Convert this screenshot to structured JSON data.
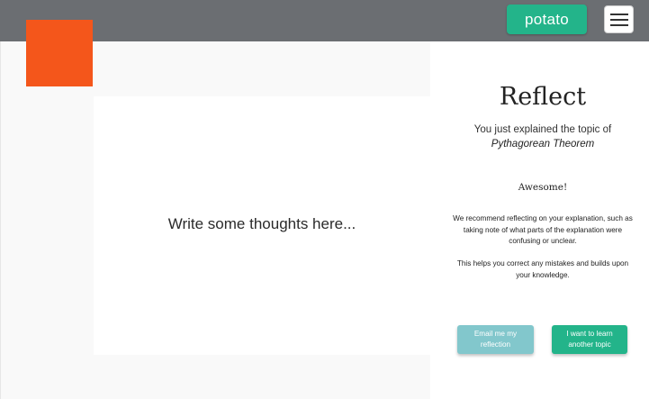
{
  "header": {
    "user_button_label": "potato",
    "menu_icon": "hamburger-menu-icon"
  },
  "notes": {
    "placeholder": "Write some thoughts here..."
  },
  "reflect": {
    "title": "Reflect",
    "intro": "You just explained the topic of",
    "topic": "Pythagorean Theorem",
    "awesome": "Awesome!",
    "recommendation": "We recommend reflecting on your explanation, such as taking note of what parts of the explanation were confusing or unclear.",
    "help": "This helps you correct any mistakes and builds upon your knowledge.",
    "email_button": "Email me my reflection",
    "learn_button": "I want to learn another topic"
  },
  "colors": {
    "topbar": "#6b6e72",
    "logo": "#f4561b",
    "primary_green": "#23b48a",
    "secondary_teal": "#82c7cc"
  }
}
